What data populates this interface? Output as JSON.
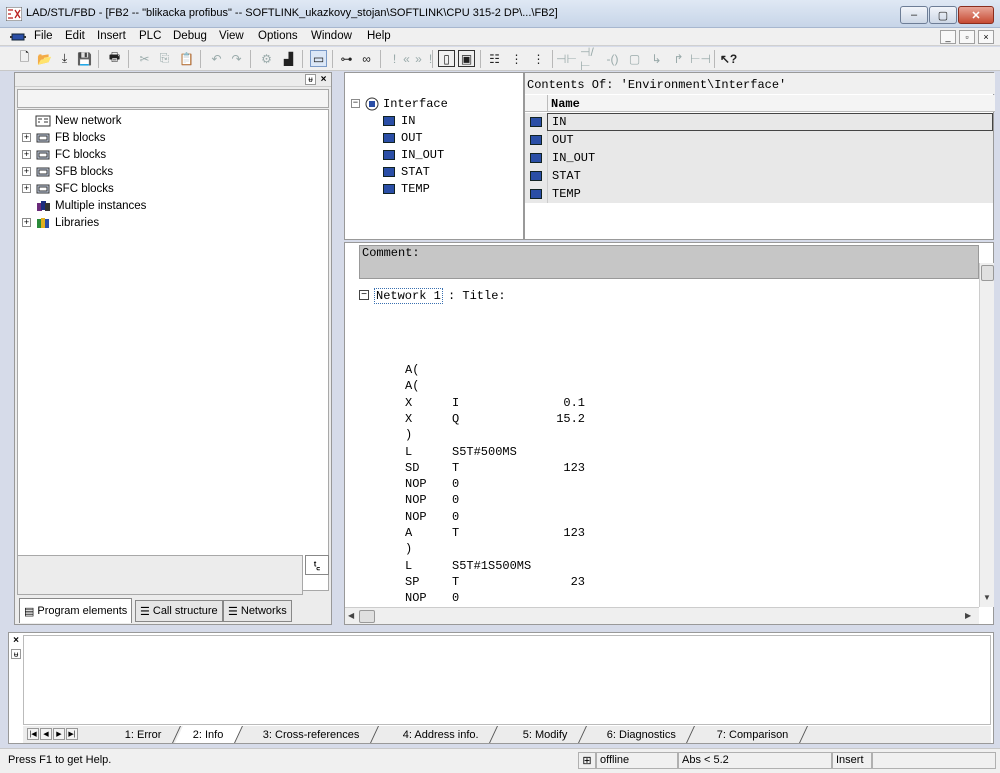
{
  "window": {
    "title": "LAD/STL/FBD  - [FB2 -- \"blikacka profibus\" -- SOFTLINK_ukazkovy_stojan\\SOFTLINK\\CPU 315-2 DP\\...\\FB2]",
    "min_glyph": "–",
    "max_glyph": "▢",
    "close_glyph": "✕"
  },
  "menu": {
    "items": [
      "File",
      "Edit",
      "Insert",
      "PLC",
      "Debug",
      "View",
      "Options",
      "Window",
      "Help"
    ],
    "mdi": [
      "_",
      "▫",
      "×"
    ]
  },
  "left_panel": {
    "pin_glyph": "ᵾ",
    "close_glyph": "×",
    "tree": [
      {
        "label": "New network",
        "expandable": false
      },
      {
        "label": "FB blocks",
        "expandable": true
      },
      {
        "label": "FC blocks",
        "expandable": true
      },
      {
        "label": "SFB blocks",
        "expandable": true
      },
      {
        "label": "SFC blocks",
        "expandable": true
      },
      {
        "label": "Multiple instances",
        "expandable": false
      },
      {
        "label": "Libraries",
        "expandable": true
      }
    ],
    "expander_glyph": "+",
    "filter_glyph": "ᵗ꜀",
    "tabs": [
      "Program elements",
      "Call structure",
      "Networks"
    ]
  },
  "interface": {
    "root": "Interface",
    "root_expander": "−",
    "children": [
      "IN",
      "OUT",
      "IN_OUT",
      "STAT",
      "TEMP"
    ],
    "contents_caption": "Contents Of: 'Environment\\Interface'",
    "column_name": "Name",
    "rows": [
      "IN",
      "OUT",
      "IN_OUT",
      "STAT",
      "TEMP"
    ]
  },
  "editor": {
    "comment_label": "Comment:",
    "network_expander": "−",
    "network_label": "Network 1",
    "network_title": ": Title:",
    "code": [
      {
        "op": "A(",
        "addr": "",
        "val": ""
      },
      {
        "op": "A(",
        "addr": "",
        "val": ""
      },
      {
        "op": "X",
        "addr": "I",
        "val": "0.1"
      },
      {
        "op": "X",
        "addr": "Q",
        "val": "15.2"
      },
      {
        "op": ")",
        "addr": "",
        "val": ""
      },
      {
        "op": "L",
        "addr": "S5T#500MS",
        "val": ""
      },
      {
        "op": "SD",
        "addr": "T",
        "val": "123"
      },
      {
        "op": "NOP",
        "addr": "0",
        "val": ""
      },
      {
        "op": "NOP",
        "addr": "0",
        "val": ""
      },
      {
        "op": "NOP",
        "addr": "0",
        "val": ""
      },
      {
        "op": "A",
        "addr": "T",
        "val": "123"
      },
      {
        "op": ")",
        "addr": "",
        "val": ""
      },
      {
        "op": "L",
        "addr": "S5T#1S500MS",
        "val": ""
      },
      {
        "op": "SP",
        "addr": "T",
        "val": "23"
      },
      {
        "op": "NOP",
        "addr": "0",
        "val": ""
      }
    ]
  },
  "bottom_panel": {
    "close_glyph": "×",
    "pin_glyph": "ᵾ",
    "tabs": [
      "1: Error",
      "2: Info",
      "3: Cross-references",
      "4: Address info.",
      "5: Modify",
      "6: Diagnostics",
      "7: Comparison"
    ],
    "active_tab": "2: Info"
  },
  "status": {
    "help": "Press F1 to get Help.",
    "mode": "offline",
    "abs": "Abs < 5.2",
    "insert": "Insert"
  }
}
